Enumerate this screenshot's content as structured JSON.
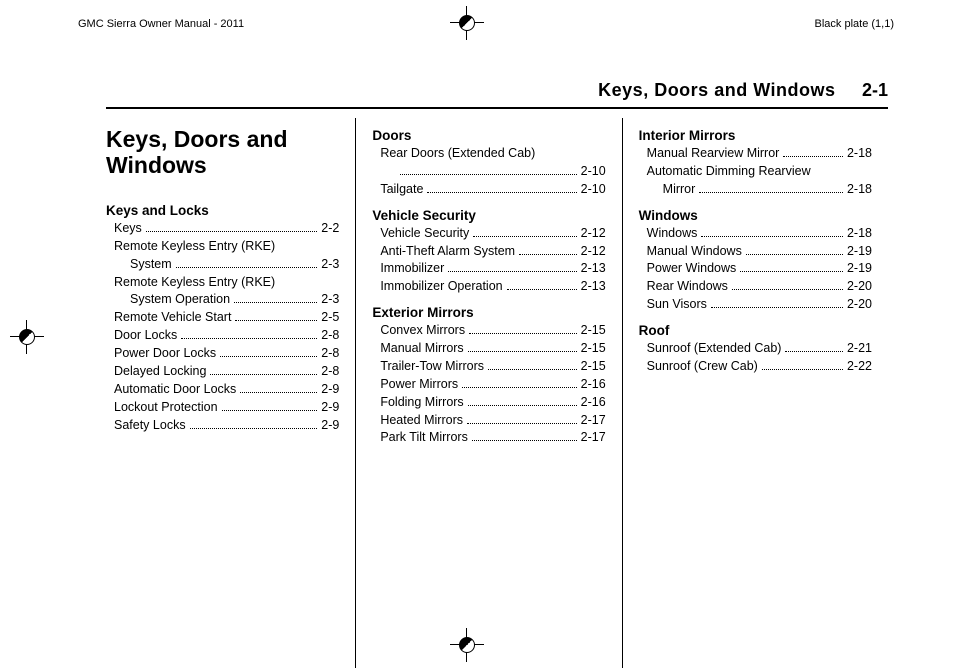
{
  "header_strip": {
    "left": "GMC Sierra Owner Manual - 2011",
    "right": "Black plate (1,1)"
  },
  "running_header": {
    "title": "Keys, Doors and Windows",
    "page": "2-1"
  },
  "chapter_title": "Keys, Doors and Windows",
  "sections": {
    "keys_and_locks": {
      "head": "Keys and Locks",
      "items": [
        {
          "label": "Keys",
          "page": "2-2"
        },
        {
          "label": "Remote Keyless Entry (RKE) System",
          "page": "2-3",
          "wrap": true
        },
        {
          "label": "Remote Keyless Entry (RKE) System Operation",
          "page": "2-3",
          "wrap": true
        },
        {
          "label": "Remote Vehicle Start",
          "page": "2-5"
        },
        {
          "label": "Door Locks",
          "page": "2-8"
        },
        {
          "label": "Power Door Locks",
          "page": "2-8"
        },
        {
          "label": "Delayed Locking",
          "page": "2-8"
        },
        {
          "label": "Automatic Door Locks",
          "page": "2-9"
        },
        {
          "label": "Lockout Protection",
          "page": "2-9"
        },
        {
          "label": "Safety Locks",
          "page": "2-9"
        }
      ]
    },
    "doors": {
      "head": "Doors",
      "items": [
        {
          "label": "Rear Doors (Extended Cab)",
          "page": "2-10",
          "wrap": true
        },
        {
          "label": "Tailgate",
          "page": "2-10"
        }
      ]
    },
    "vehicle_security": {
      "head": "Vehicle Security",
      "items": [
        {
          "label": "Vehicle Security",
          "page": "2-12"
        },
        {
          "label": "Anti-Theft Alarm System",
          "page": "2-12"
        },
        {
          "label": "Immobilizer",
          "page": "2-13"
        },
        {
          "label": "Immobilizer Operation",
          "page": "2-13"
        }
      ]
    },
    "exterior_mirrors": {
      "head": "Exterior Mirrors",
      "items": [
        {
          "label": "Convex Mirrors",
          "page": "2-15"
        },
        {
          "label": "Manual Mirrors",
          "page": "2-15"
        },
        {
          "label": "Trailer-Tow Mirrors",
          "page": "2-15"
        },
        {
          "label": "Power Mirrors",
          "page": "2-16"
        },
        {
          "label": "Folding Mirrors",
          "page": "2-16"
        },
        {
          "label": "Heated Mirrors",
          "page": "2-17"
        },
        {
          "label": "Park Tilt Mirrors",
          "page": "2-17"
        }
      ]
    },
    "interior_mirrors": {
      "head": "Interior Mirrors",
      "items": [
        {
          "label": "Manual Rearview Mirror",
          "page": "2-18"
        },
        {
          "label": "Automatic Dimming Rearview Mirror",
          "page": "2-18",
          "wrap": true
        }
      ]
    },
    "windows": {
      "head": "Windows",
      "items": [
        {
          "label": "Windows",
          "page": "2-18"
        },
        {
          "label": "Manual Windows",
          "page": "2-19"
        },
        {
          "label": "Power Windows",
          "page": "2-19"
        },
        {
          "label": "Rear Windows",
          "page": "2-20"
        },
        {
          "label": "Sun Visors",
          "page": "2-20"
        }
      ]
    },
    "roof": {
      "head": "Roof",
      "items": [
        {
          "label": "Sunroof (Extended Cab)",
          "page": "2-21"
        },
        {
          "label": "Sunroof (Crew Cab)",
          "page": "2-22"
        }
      ]
    }
  }
}
